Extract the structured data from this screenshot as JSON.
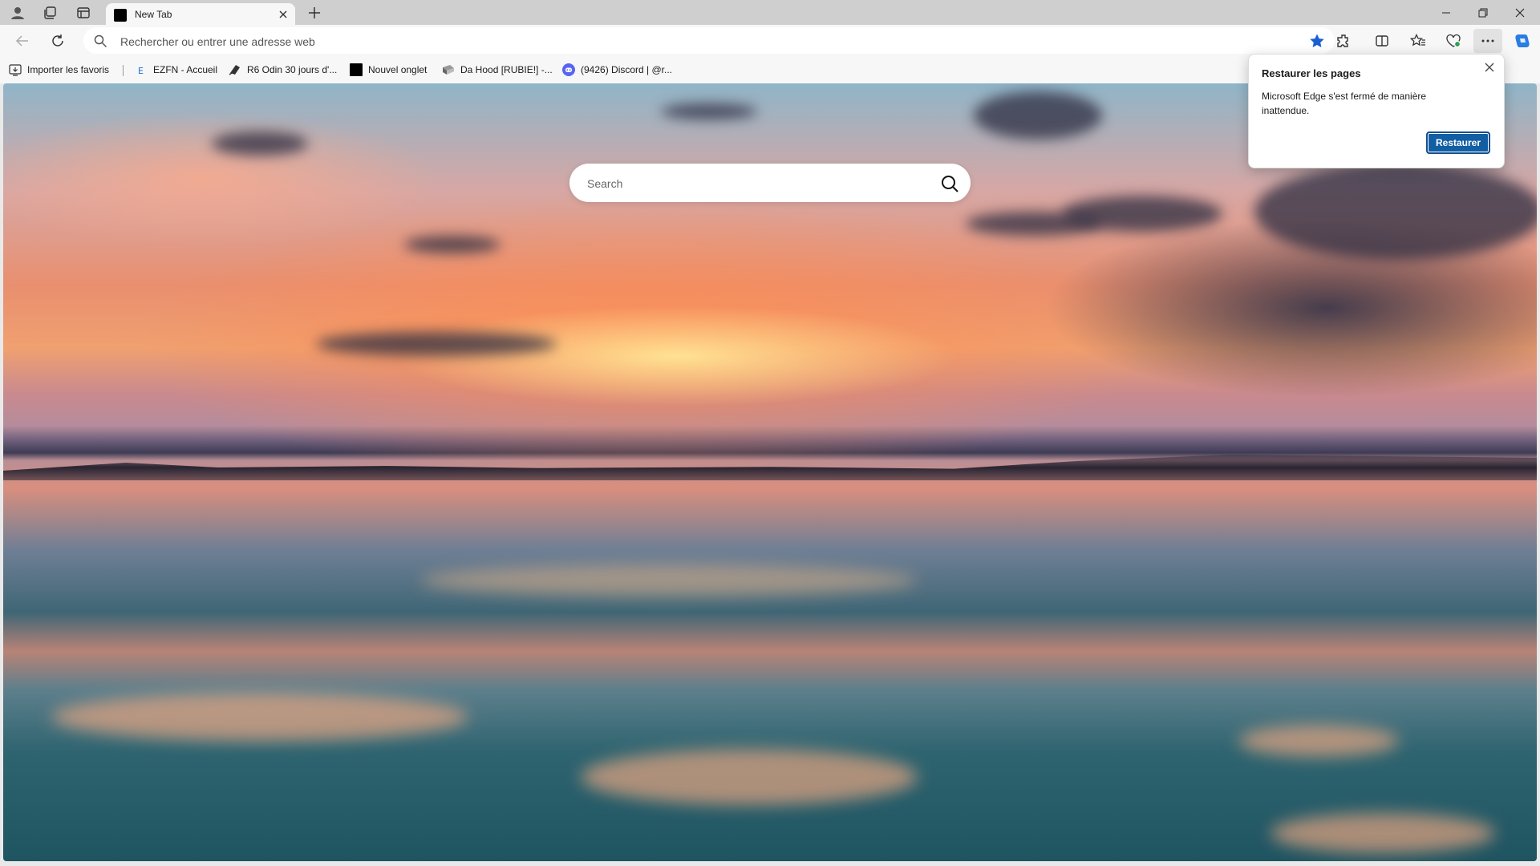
{
  "tab": {
    "title": "New Tab"
  },
  "addressbar": {
    "placeholder": "Rechercher ou entrer une adresse web"
  },
  "favorites": [
    {
      "label": "Importer les favoris",
      "icon": "import-icon"
    },
    {
      "label": "EZFN - Accueil",
      "icon": "ezfn-icon"
    },
    {
      "label": "R6 Odin 30 jours d'...",
      "icon": "r6-icon"
    },
    {
      "label": "Nouvel onglet",
      "icon": "black-square-icon"
    },
    {
      "label": "Da Hood [RUBIE!] -...",
      "icon": "dahood-icon"
    },
    {
      "label": "(9426) Discord | @r...",
      "icon": "discord-icon"
    }
  ],
  "ntp": {
    "search_placeholder": "Search"
  },
  "popup": {
    "title": "Restaurer les pages",
    "message": "Microsoft Edge s'est fermé de manière inattendue.",
    "button": "Restaurer"
  },
  "colors": {
    "accent": "#115ea3",
    "star": "#1a5fd0",
    "copilot": "#2a7de1"
  }
}
